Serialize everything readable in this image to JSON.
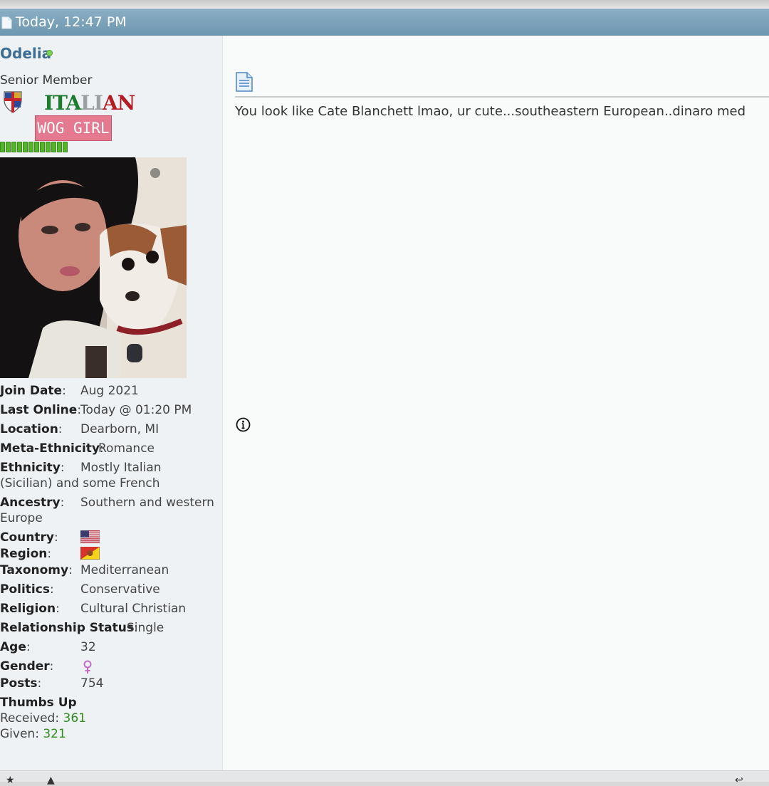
{
  "post": {
    "timestamp": "Today, 12:47 PM",
    "message": "You look like Cate Blanchett lmao, ur cute...southeastern European..dinaro med"
  },
  "user": {
    "username": "Odelia",
    "title": "Senior Member",
    "badge_italian": [
      "ITA",
      "LI",
      "AN"
    ],
    "badge_wog": "WOG GIRL",
    "reputation_pips": 12,
    "fields": {
      "join_date": {
        "label": "Join Date",
        "value": "Aug 2021"
      },
      "last_online": {
        "label": "Last Online",
        "value": "Today @ 01:20 PM"
      },
      "location": {
        "label": "Location",
        "value": "Dearborn, MI"
      },
      "meta_ethnicity": {
        "label": "Meta-Ethnicity",
        "value": "Romance"
      },
      "ethnicity": {
        "label": "Ethnicity",
        "value": "Mostly Italian",
        "value_cont": "(Sicilian) and some French"
      },
      "ancestry": {
        "label": "Ancestry",
        "value": "Southern and western",
        "value_cont": "Europe"
      },
      "country": {
        "label": "Country"
      },
      "region": {
        "label": "Region"
      },
      "taxonomy": {
        "label": "Taxonomy",
        "value": "Mediterranean"
      },
      "politics": {
        "label": "Politics",
        "value": "Conservative"
      },
      "religion": {
        "label": "Religion",
        "value": "Cultural Christian"
      },
      "relationship": {
        "label": "Relationship Status",
        "value": "Single"
      },
      "age": {
        "label": "Age",
        "value": "32"
      },
      "gender": {
        "label": "Gender"
      },
      "posts": {
        "label": "Posts",
        "value": "754"
      }
    },
    "thumbs": {
      "heading": "Thumbs Up",
      "received_label": "Received",
      "received": "361",
      "given_label": "Given",
      "given": "321"
    }
  },
  "icons": {
    "header": "document-icon",
    "post": "document-icon",
    "info": "info-icon",
    "online": "online-status-icon",
    "gender": "female-symbol-icon"
  },
  "colors": {
    "header_bg": "#7aa1b9",
    "username": "#3e6d93",
    "online": "#7fd05b",
    "thumbs_count": "#2f8d1e"
  }
}
